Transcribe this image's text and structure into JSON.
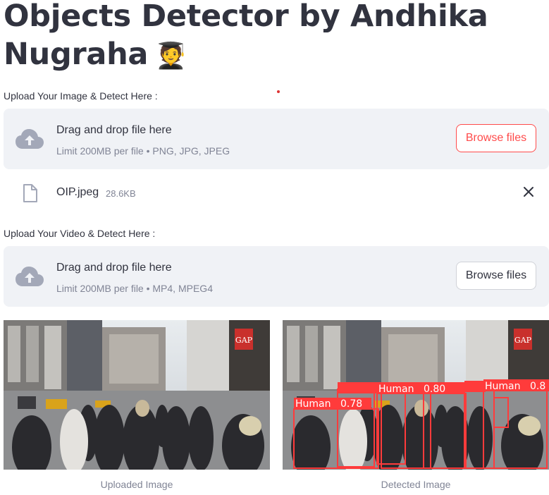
{
  "title": "Objects Detector by Andhika Nugraha",
  "title_emoji": "🧑‍🎓",
  "image_upload": {
    "label": "Upload Your Image & Detect Here :",
    "dropzone_title": "Drag and drop file here",
    "limit_text": "Limit 200MB per file • PNG, JPG, JPEG",
    "browse_label": "Browse files",
    "file": {
      "name": "OIP.jpeg",
      "size": "28.6KB"
    }
  },
  "video_upload": {
    "label": "Upload Your Video & Detect Here :",
    "dropzone_title": "Drag and drop file here",
    "limit_text": "Limit 200MB per file • MP4, MPEG4",
    "browse_label": "Browse files"
  },
  "images": {
    "uploaded_caption": "Uploaded Image",
    "detected_caption": "Detected Image",
    "store_sign": "GAP",
    "detections": [
      {
        "label": "Human",
        "score": "0.78"
      },
      {
        "label": "Human",
        "score": "0.80"
      },
      {
        "label": "Human",
        "score": "0.8"
      }
    ]
  },
  "colors": {
    "accent": "#ff4b4b",
    "dropzone_bg": "#f0f2f6",
    "text": "#31333f",
    "muted": "#808495"
  }
}
